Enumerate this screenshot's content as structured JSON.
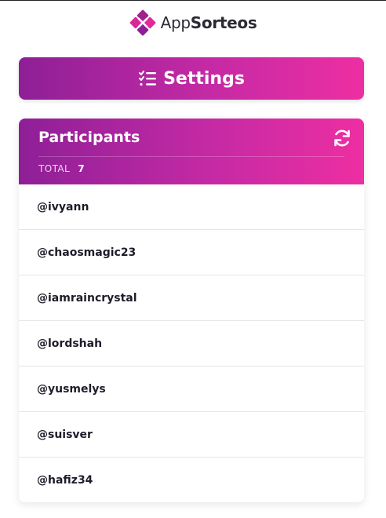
{
  "brand": {
    "name_light": "App",
    "name_bold": "Sorteos",
    "accent": "#c42aa4"
  },
  "settings_button": {
    "label": "Settings",
    "icon": "checklist-icon"
  },
  "participants_card": {
    "title": "Participants",
    "refresh_icon": "refresh-icon",
    "total_label": "TOTAL",
    "total_count": "7",
    "items": [
      "@ivyann",
      "@chaosmagic23",
      "@iamraincrystal",
      "@lordshah",
      "@yusmelys",
      "@suisver",
      "@hafiz34"
    ]
  }
}
